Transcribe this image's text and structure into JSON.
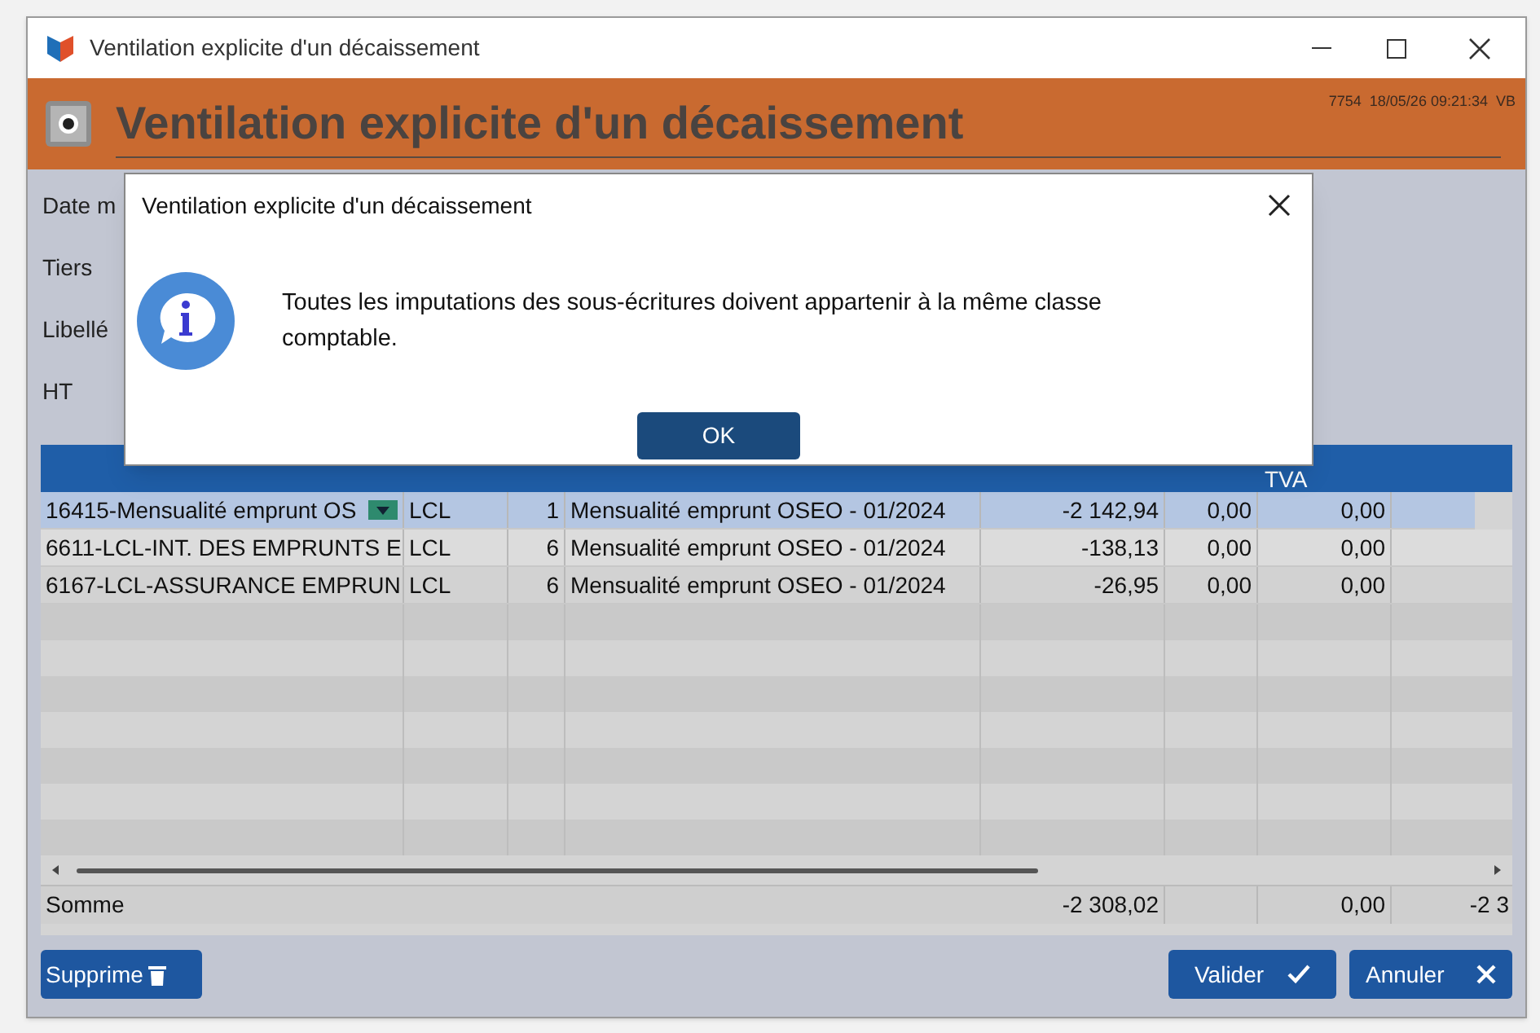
{
  "window": {
    "title": "Ventilation explicite d'un décaissement"
  },
  "header": {
    "title": "Ventilation explicite d'un décaissement",
    "info": "7754  18/05/26 09:21:34  VB"
  },
  "form": {
    "fields": [
      {
        "label": "Date m"
      },
      {
        "label": "Tiers"
      },
      {
        "label": "Libellé"
      },
      {
        "label": "HT"
      }
    ]
  },
  "table": {
    "tva_header": "TVA",
    "rows": [
      {
        "imputation": "16415-Mensualité emprunt OS",
        "journal": "LCL",
        "n": "1",
        "libelle": "Mensualité emprunt OSEO - 01/2024",
        "ht": "-2 142,94",
        "column_6": "0,00",
        "tva": "0,00",
        "selected": true
      },
      {
        "imputation": "6611-LCL-INT. DES EMPRUNTS E",
        "journal": "LCL",
        "n": "6",
        "libelle": "Mensualité emprunt OSEO - 01/2024",
        "ht": "-138,13",
        "column_6": "0,00",
        "tva": "0,00",
        "selected": false
      },
      {
        "imputation": "6167-LCL-ASSURANCE EMPRUN",
        "journal": "LCL",
        "n": "6",
        "libelle": "Mensualité emprunt OSEO - 01/2024",
        "ht": "-26,95",
        "column_6": "0,00",
        "tva": "0,00",
        "selected": false
      }
    ],
    "total": {
      "label": "Somme",
      "ht": "-2 308,02",
      "tva": "0,00",
      "column_8": "-2 3"
    }
  },
  "buttons": {
    "delete": "Supprime",
    "validate": "Valider",
    "cancel": "Annuler"
  },
  "dialog": {
    "title": "Ventilation explicite d'un décaissement",
    "message": "Toutes les imputations des sous-écritures doivent appartenir à la même classe comptable.",
    "ok": "OK"
  }
}
